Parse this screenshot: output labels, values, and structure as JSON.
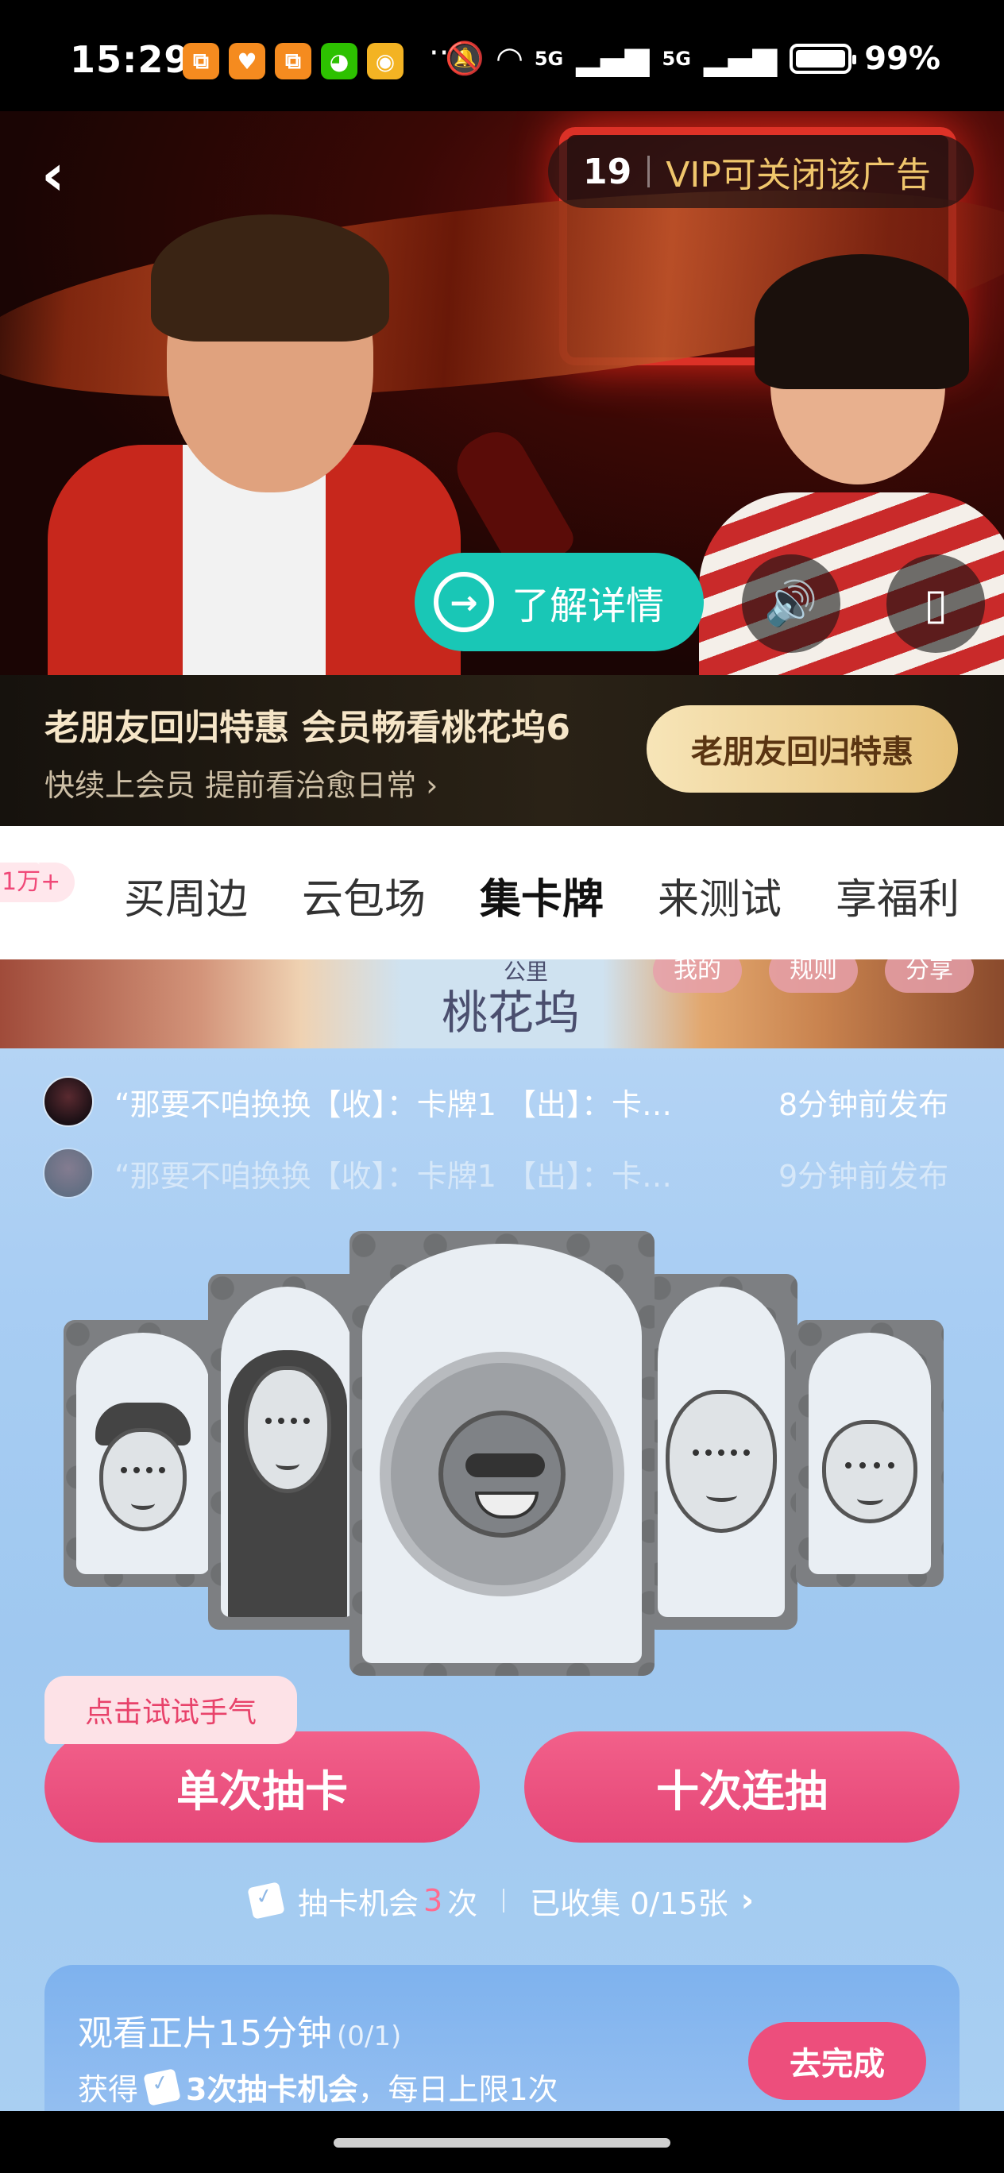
{
  "status_bar": {
    "time": "15:29",
    "apps": [
      {
        "name": "tiktok-lite-icon",
        "glyph": "⧉",
        "color": "#f58b1f"
      },
      {
        "name": "heart-app-icon",
        "glyph": "♥",
        "color": "#f58b1f"
      },
      {
        "name": "tiktok-lite-icon-2",
        "glyph": "⧉",
        "color": "#f58b1f"
      },
      {
        "name": "wechat-icon",
        "glyph": "◕",
        "color": "#2dc100"
      },
      {
        "name": "weibo-icon",
        "glyph": "◉",
        "color": "#f3b323"
      }
    ],
    "more": "···",
    "network1": "5G",
    "network2": "5G",
    "battery": "99%"
  },
  "ad": {
    "countdown": "19",
    "vip_close": "VIP可关闭该广告",
    "details_label": "了解详情",
    "back_glyph": "‹",
    "sound_glyph": "🔊",
    "rotate_glyph": "▯"
  },
  "promo": {
    "title": "老朋友回归特惠 会员畅看桃花坞6",
    "subtitle": "快续上会员 提前看治愈日常 ›",
    "button": "老朋友回归特惠"
  },
  "tabs": {
    "badge": "1万+",
    "items": [
      "买周边",
      "云包场",
      "集卡牌",
      "来测试",
      "享福利"
    ],
    "active": "集卡牌"
  },
  "banner": {
    "small_title": "公里",
    "title": "桃花坞",
    "chips": [
      "我的",
      "规则",
      "分享"
    ]
  },
  "feed": [
    {
      "text": "“那要不咱换换【收】：卡牌1 【出】：卡…",
      "time": "8分钟前发布"
    },
    {
      "text": "“那要不咱换换【收】：卡牌1 【出】：卡…",
      "time": "9分钟前发布"
    }
  ],
  "draw": {
    "hint": "点击试试手气",
    "single": "单次抽卡",
    "ten": "十次连抽",
    "chance_prefix": "抽卡机会",
    "chance_count": "3",
    "chance_suffix": "次",
    "collected": "已收集 0/15张"
  },
  "task": {
    "title": "观看正片15分钟",
    "progress": "(0/1)",
    "desc_prefix": "获得",
    "desc_reward": "3次抽卡机会",
    "desc_suffix": "，每日上限1次",
    "button": "去完成"
  },
  "colors": {
    "accent_pink": "#e54677",
    "teal": "#19c7b6",
    "gold": "#e6c178"
  }
}
